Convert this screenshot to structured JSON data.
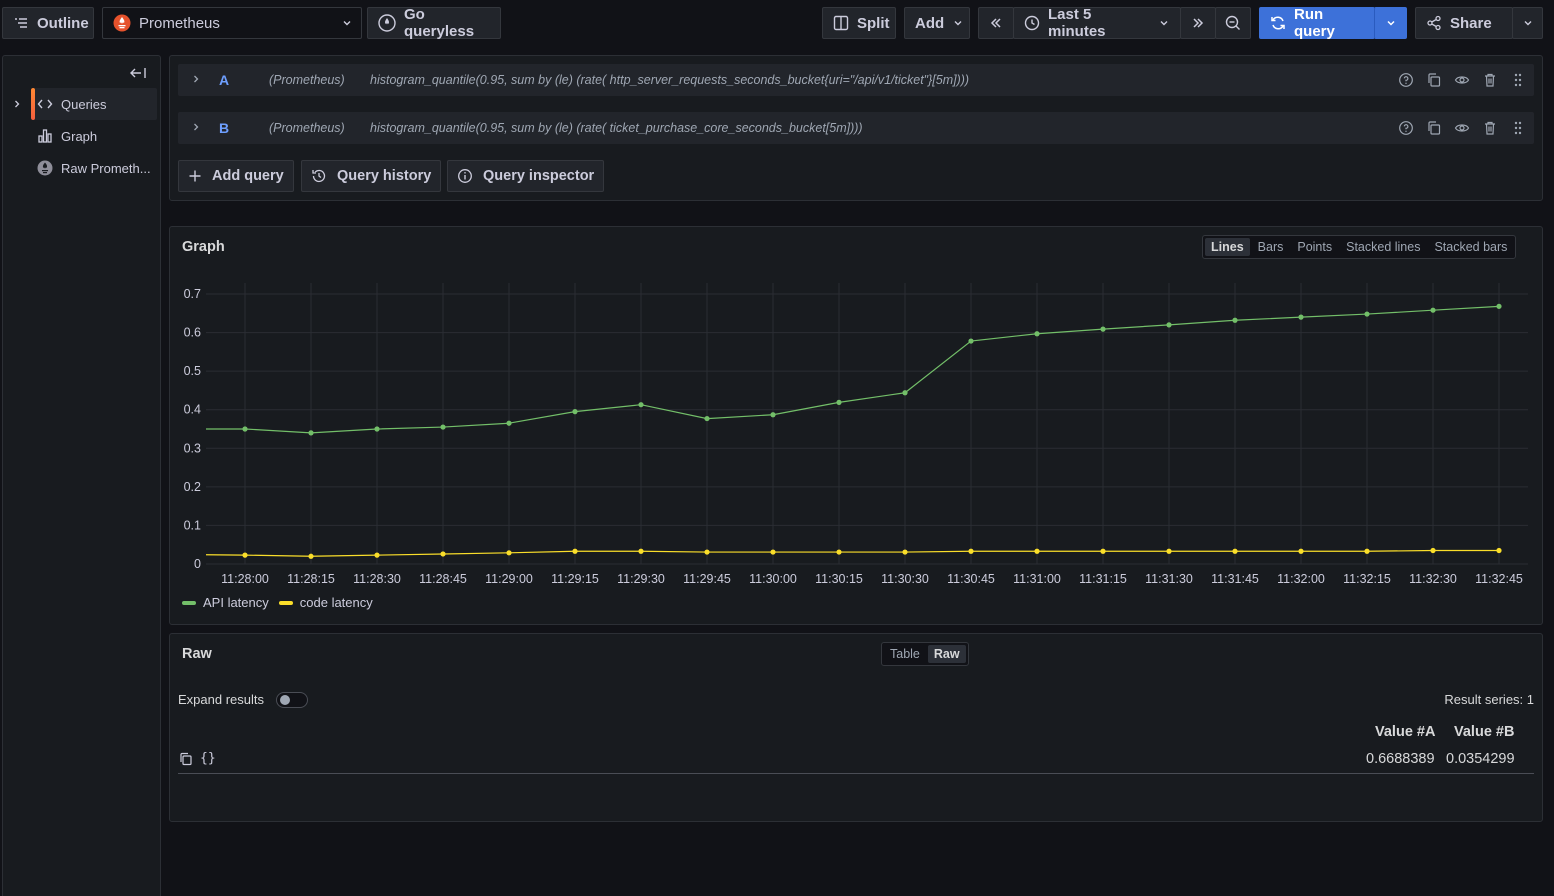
{
  "toolbar": {
    "outline_label": "Outline",
    "datasource": "Prometheus",
    "queryless_label": "Go queryless",
    "split_label": "Split",
    "add_label": "Add",
    "time_range": "Last 5 minutes",
    "run_label": "Run query",
    "share_label": "Share"
  },
  "sidebar": {
    "items": [
      {
        "label": "Queries",
        "icon": "code-icon"
      },
      {
        "label": "Graph",
        "icon": "bar-chart-icon"
      },
      {
        "label": "Raw Prometh...",
        "icon": "prometheus-icon"
      }
    ]
  },
  "queries": [
    {
      "name": "A",
      "datasource": "(Prometheus)",
      "expr": "histogram_quantile(0.95, sum by (le) (rate( http_server_requests_seconds_bucket{uri=\"/api/v1/ticket\"}[5m])))"
    },
    {
      "name": "B",
      "datasource": "(Prometheus)",
      "expr": "histogram_quantile(0.95, sum by (le) (rate( ticket_purchase_core_seconds_bucket[5m])))"
    }
  ],
  "query_actions": {
    "add_query": "Add query",
    "history": "Query history",
    "inspector": "Query inspector"
  },
  "graph_panel": {
    "title": "Graph",
    "modes": [
      "Lines",
      "Bars",
      "Points",
      "Stacked lines",
      "Stacked bars"
    ],
    "selected_mode": "Lines"
  },
  "chart_data": {
    "type": "line",
    "x": [
      "11:28:00",
      "11:28:15",
      "11:28:30",
      "11:28:45",
      "11:29:00",
      "11:29:15",
      "11:29:30",
      "11:29:45",
      "11:30:00",
      "11:30:15",
      "11:30:30",
      "11:30:45",
      "11:31:00",
      "11:31:15",
      "11:31:30",
      "11:31:45",
      "11:32:00",
      "11:32:15",
      "11:32:30",
      "11:32:45"
    ],
    "yticks": [
      0,
      0.1,
      0.2,
      0.3,
      0.4,
      0.5,
      0.6,
      0.7
    ],
    "ylim": [
      0,
      0.7
    ],
    "grid": true,
    "legend_position": "bottom-left",
    "series": [
      {
        "name": "API latency",
        "color": "#73bf69",
        "lead": 0.35,
        "values": [
          0.35,
          0.34,
          0.35,
          0.355,
          0.365,
          0.395,
          0.413,
          0.377,
          0.387,
          0.419,
          0.444,
          0.578,
          0.597,
          0.609,
          0.62,
          0.632,
          0.64,
          0.648,
          0.658,
          0.668
        ]
      },
      {
        "name": "code latency",
        "color": "#fade2a",
        "lead": 0.024,
        "values": [
          0.023,
          0.02,
          0.023,
          0.026,
          0.029,
          0.033,
          0.033,
          0.031,
          0.031,
          0.031,
          0.031,
          0.033,
          0.033,
          0.033,
          0.033,
          0.033,
          0.033,
          0.033,
          0.035,
          0.035
        ]
      }
    ]
  },
  "raw_panel": {
    "title": "Raw",
    "views": [
      "Table",
      "Raw"
    ],
    "selected_view": "Raw",
    "expand_label": "Expand results",
    "result_series": "Result series: 1",
    "columns": [
      "Value #A",
      "Value #B"
    ],
    "row_label": "{}",
    "values": [
      "0.6688389",
      "0.0354299"
    ]
  }
}
